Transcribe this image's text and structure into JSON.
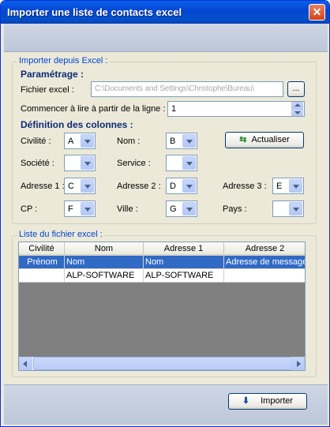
{
  "window": {
    "title": "Importer une liste de contacts excel",
    "close_glyph": "✕"
  },
  "import_group": {
    "legend": "Importer depuis Excel :",
    "param_title": "Paramétrage :",
    "file_label": "Fichier excel :",
    "file_value": "C:\\Documents and Settings\\Christophe\\Bureau\\",
    "browse_label": "...",
    "start_label": "Commencer à lire à partir de la ligne :",
    "start_value": "1",
    "columns_title": "Définition des colonnes :",
    "refresh_label": "Actualiser",
    "fields": {
      "civilite": {
        "label": "Civilité :",
        "value": "A"
      },
      "nom": {
        "label": "Nom :",
        "value": "B"
      },
      "societe": {
        "label": "Société :",
        "value": ""
      },
      "service": {
        "label": "Service :",
        "value": ""
      },
      "adresse1": {
        "label": "Adresse 1 :",
        "value": "C"
      },
      "adresse2": {
        "label": "Adresse 2 :",
        "value": "D"
      },
      "adresse3": {
        "label": "Adresse 3 :",
        "value": "E"
      },
      "cp": {
        "label": "CP :",
        "value": "F"
      },
      "ville": {
        "label": "Ville :",
        "value": "G"
      },
      "pays": {
        "label": "Pays :",
        "value": ""
      }
    }
  },
  "list_group": {
    "legend": "Liste du fichier excel :",
    "columns": [
      "Civilité",
      "Nom",
      "Adresse 1",
      "Adresse 2"
    ],
    "rows": [
      [
        "Prénom",
        "Nom",
        "Nom",
        "Adresse de message"
      ],
      [
        "",
        "ALP-SOFTWARE",
        "ALP-SOFTWARE",
        ""
      ]
    ]
  },
  "footer": {
    "import_label": "Importer"
  },
  "colors": {
    "title_bar": "#0a5fe9",
    "selection": "#316ac5",
    "group_legend": "#0046d5"
  }
}
